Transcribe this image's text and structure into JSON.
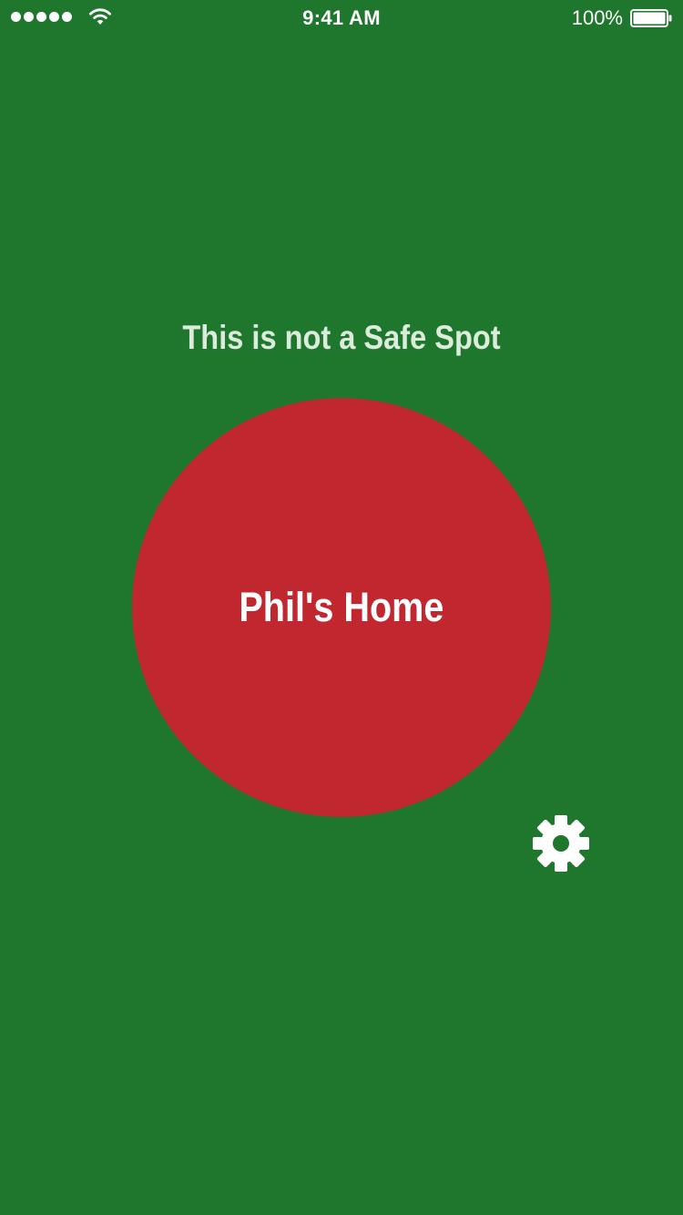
{
  "status_bar": {
    "time": "9:41 AM",
    "battery_percent": "100%",
    "signal_bars": 5,
    "icons": [
      "signal-dots-icon",
      "wifi-icon",
      "battery-icon"
    ]
  },
  "main": {
    "status_message": "This is not a Safe Spot",
    "place_button_label": "Phil's Home",
    "settings_icon": "gear-icon"
  },
  "colors": {
    "background": "#1e772c",
    "place_circle": "#c1272f",
    "message_text": "#dcebdc",
    "foreground": "#ffffff"
  }
}
